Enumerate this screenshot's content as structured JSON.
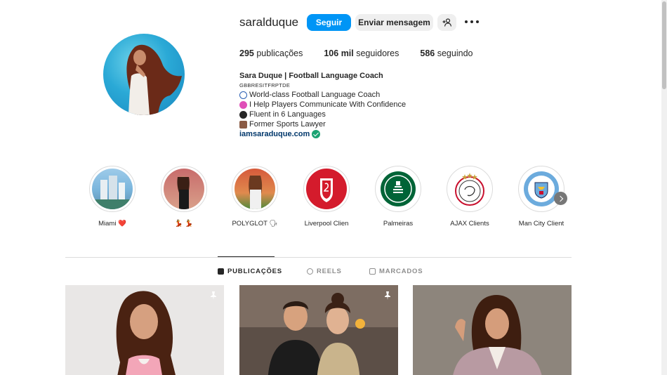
{
  "profile": {
    "username": "saralduque",
    "follow_label": "Seguir",
    "message_label": "Enviar mensagem",
    "suggest_icon": "person-add-icon",
    "more_icon": "more-horizontal-icon"
  },
  "stats": {
    "posts_count": "295",
    "posts_label": "publicações",
    "followers_count": "106 mil",
    "followers_label": "seguidores",
    "following_count": "586",
    "following_label": "seguindo"
  },
  "bio": {
    "name": "Sara Duque | Football Language Coach",
    "category": "GBBRESITFRPTDE",
    "lines": [
      {
        "icon": "soccer-ball-icon",
        "text": "World-class Football Language Coach"
      },
      {
        "icon": "speech-bubble-icon",
        "text": "I Help Players Communicate With Confidence"
      },
      {
        "icon": "speaking-head-icon",
        "text": "Fluent in 6 Languages"
      },
      {
        "icon": "judge-icon",
        "text": "Former Sports Lawyer"
      }
    ],
    "link": "iamsaraduque.com"
  },
  "highlights": [
    {
      "label": "Miami ❤️"
    },
    {
      "label": "💃 💃"
    },
    {
      "label": "POLYGLOT 🗣"
    },
    {
      "label": "Liverpool Clien"
    },
    {
      "label": "Palmeiras"
    },
    {
      "label": "AJAX Clients"
    },
    {
      "label": "Man City Client"
    }
  ],
  "tabs": {
    "posts": "PUBLICAÇÕES",
    "reels": "REELS",
    "tagged": "MARCADOS"
  },
  "colors": {
    "primary_button": "#0095f6",
    "verified": "#1ba373",
    "link": "#00376b",
    "divider": "#dbdbdb"
  }
}
